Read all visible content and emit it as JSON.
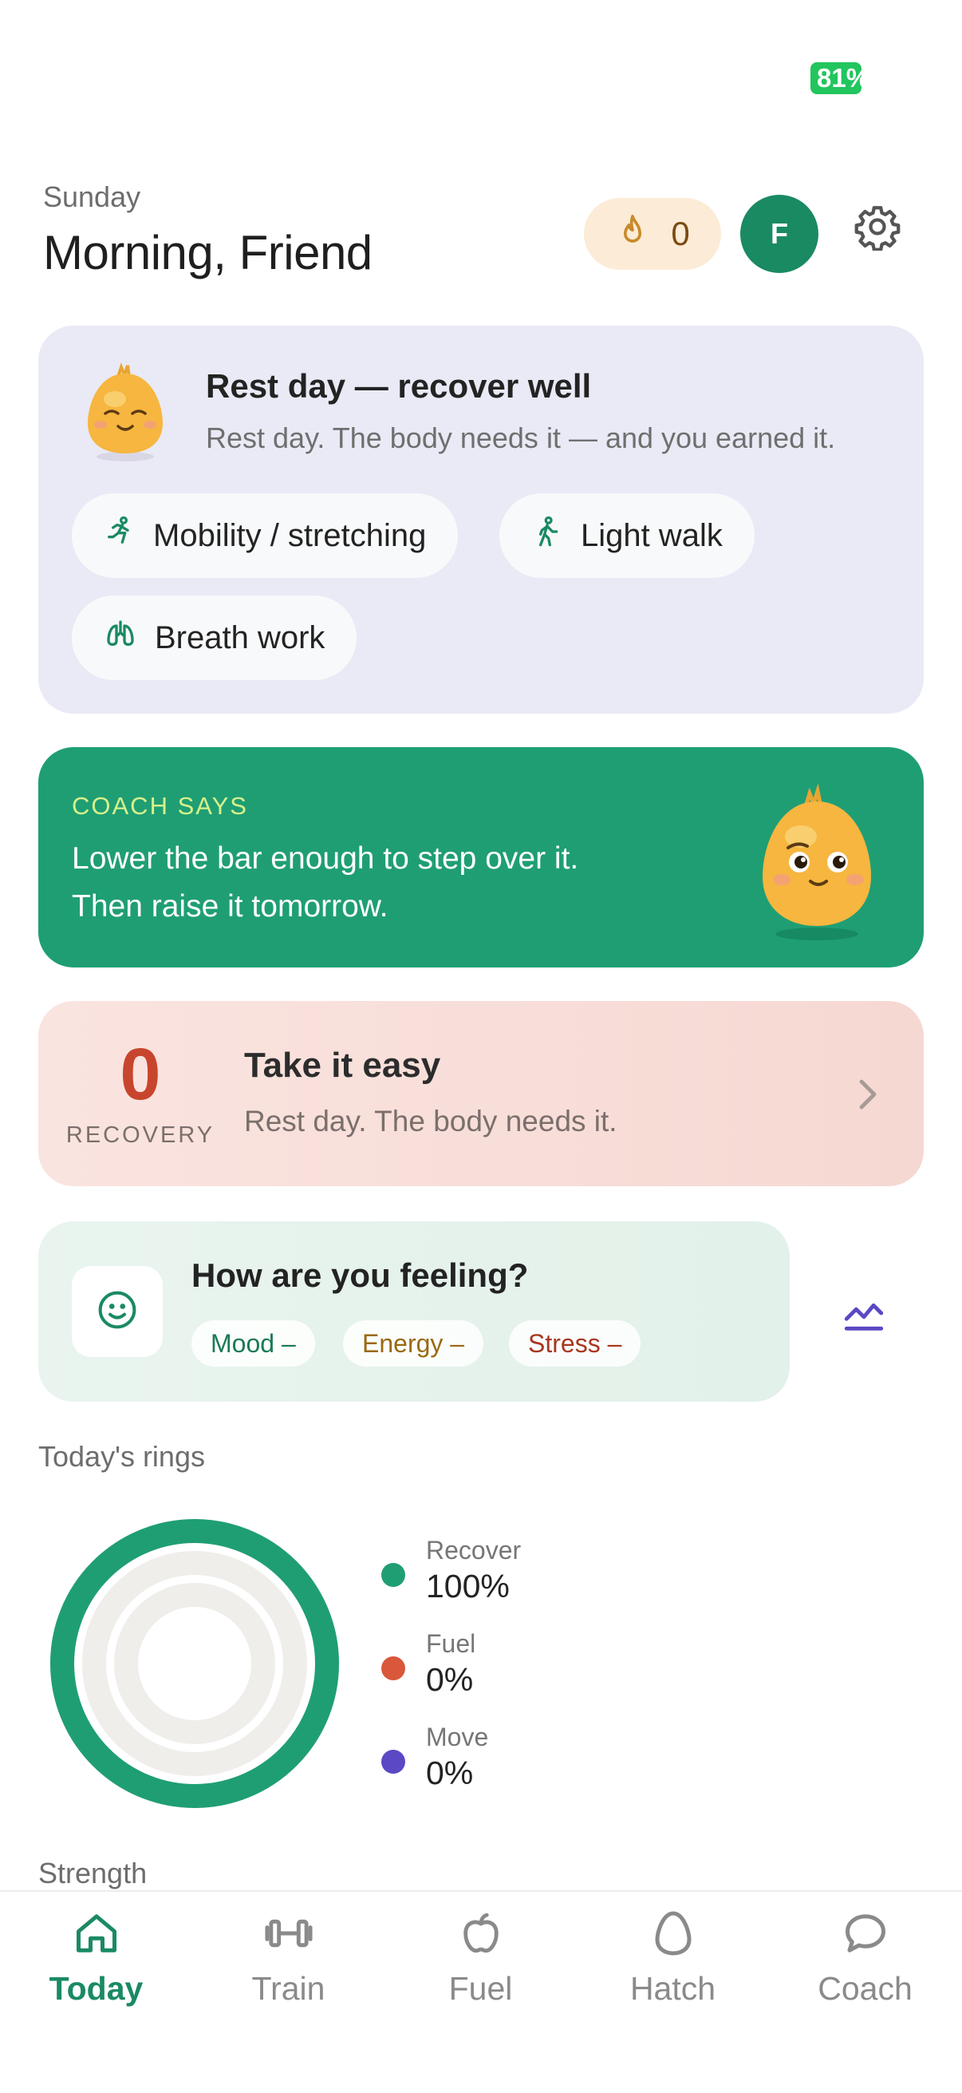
{
  "status_bar": {
    "battery": "81%"
  },
  "header": {
    "day": "Sunday",
    "greeting": "Morning, Friend",
    "streak_count": "0",
    "avatar_initial": "F"
  },
  "rest_card": {
    "title": "Rest day — recover well",
    "subtitle": "Rest day. The body needs it — and you earned it.",
    "chips": [
      {
        "label": "Mobility / stretching",
        "icon": "stretching-icon"
      },
      {
        "label": "Light walk",
        "icon": "walking-icon"
      },
      {
        "label": "Breath work",
        "icon": "lungs-icon"
      }
    ]
  },
  "coach_card": {
    "label": "COACH SAYS",
    "quote": "Lower the bar enough to step over it. Then raise it tomorrow."
  },
  "recovery_card": {
    "score": "0",
    "label": "RECOVERY",
    "title": "Take it easy",
    "subtitle": "Rest day. The body needs it."
  },
  "feeling_card": {
    "title": "How are you feeling?",
    "tags": [
      "Mood –",
      "Energy –",
      "Stress –"
    ]
  },
  "rings": {
    "heading": "Today's rings",
    "items": [
      {
        "name": "Recover",
        "value": "100%",
        "fraction": 1.0,
        "color": "#1f9e74"
      },
      {
        "name": "Fuel",
        "value": "0%",
        "fraction": 0.0,
        "color": "#d9573a"
      },
      {
        "name": "Move",
        "value": "0%",
        "fraction": 0.0,
        "color": "#5a48c4"
      }
    ]
  },
  "next_section": {
    "heading": "Strength"
  },
  "tabbar": {
    "tabs": [
      {
        "label": "Today",
        "icon": "home-icon",
        "active": true
      },
      {
        "label": "Train",
        "icon": "dumbbell-icon",
        "active": false
      },
      {
        "label": "Fuel",
        "icon": "apple-icon",
        "active": false
      },
      {
        "label": "Hatch",
        "icon": "egg-icon",
        "active": false
      },
      {
        "label": "Coach",
        "icon": "chat-bubble-icon",
        "active": false
      }
    ]
  },
  "colors": {
    "brand_green": "#1a8a63",
    "coach_green": "#1f9e74",
    "recovery_red": "#c8452d",
    "accent_purple": "#5a48c4"
  }
}
